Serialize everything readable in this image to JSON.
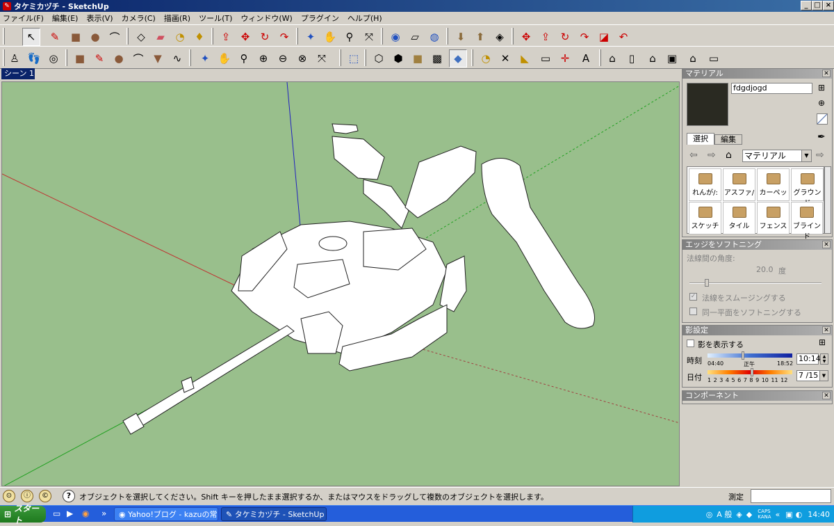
{
  "window": {
    "title": "タケミカヅチ - SketchUp"
  },
  "menu": [
    "ファイル(F)",
    "編集(E)",
    "表示(V)",
    "カメラ(C)",
    "描画(R)",
    "ツール(T)",
    "ウィンドウ(W)",
    "プラグイン",
    "ヘルプ(H)"
  ],
  "scene_tab": "シーン 1",
  "materials": {
    "header": "マテリアル",
    "name_value": "fdgdjogd",
    "tab_select": "選択",
    "tab_edit": "編集",
    "dropdown_value": "マテリアル",
    "tiles": [
      "れんが/:",
      "アスファ/",
      "カーペッ",
      "グラウンド",
      "スケッチ",
      "タイル",
      "フェンス",
      "ブラインド"
    ]
  },
  "edge_softening": {
    "header": "エッジをソフトニング",
    "angle_label": "法線間の角度:",
    "angle_value": "20.0",
    "angle_unit": "度",
    "smooth_label": "法線をスムージングする",
    "coplanar_label": "同一平面をソフトニングする"
  },
  "shadows": {
    "header": "影設定",
    "show_label": "影を表示する",
    "time_label": "時刻",
    "time_start": "04:40",
    "time_noon": "正午",
    "time_end": "18:52",
    "time_value": "10:14",
    "date_label": "日付",
    "date_scale": "1 2 3 4 5 6 7 8 9 10 11 12",
    "date_value": "7 /15"
  },
  "components": {
    "header": "コンポーネント"
  },
  "status": {
    "message": "オブジェクトを選択してください。Shift キーを押したまま選択するか、またはマウスをドラッグして複数のオブジェクトを選択します。",
    "measure_label": "測定"
  },
  "taskbar": {
    "start": "スタート",
    "tasks": [
      "Yahoo!ブログ - kazuの常...",
      "タケミカヅチ - SketchUp"
    ],
    "tray_caps": "CAPS",
    "tray_kana": "KANA",
    "clock": "14:40"
  },
  "colors": {
    "viewport_bg": "#99bf8c",
    "title_bg": "#0a246a",
    "taskbar_bg": "#245edb"
  }
}
